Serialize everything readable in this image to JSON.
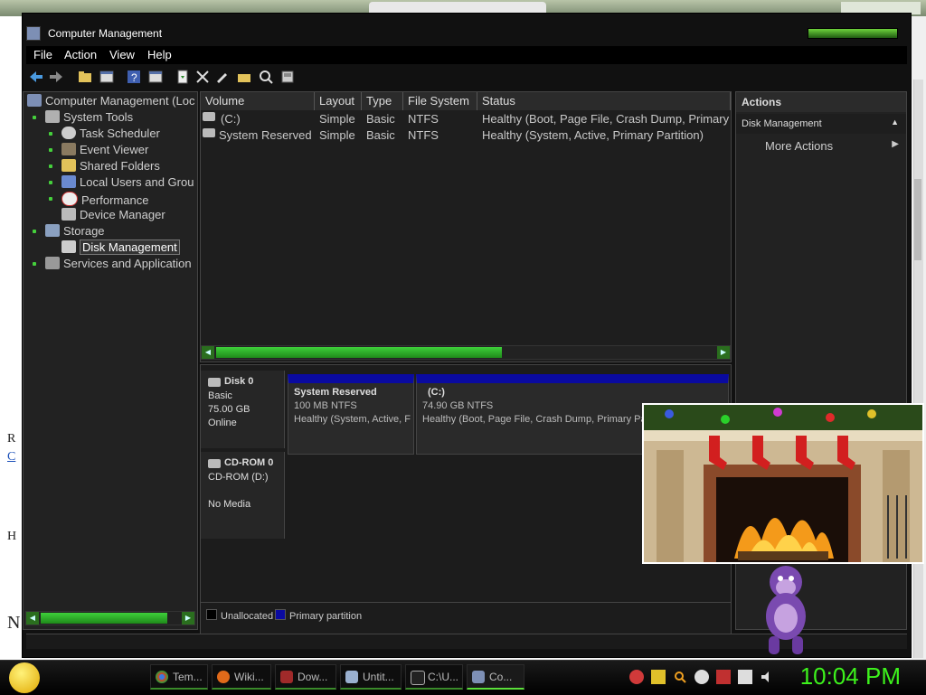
{
  "window": {
    "title": "Computer Management"
  },
  "menu": [
    "File",
    "Action",
    "View",
    "Help"
  ],
  "toolbar_icons": [
    "back-icon",
    "forward-icon",
    "up-folder-icon",
    "show-hide-tree-icon",
    "help-icon",
    "properties-icon",
    "refresh-icon",
    "delete-icon",
    "rename-icon",
    "open-folder-icon",
    "search-icon",
    "disk-icon"
  ],
  "tree": {
    "root": "Computer Management (Loc",
    "system_tools": "System Tools",
    "task_scheduler": "Task Scheduler",
    "event_viewer": "Event Viewer",
    "shared_folders": "Shared Folders",
    "local_users": "Local Users and Grou",
    "performance": "Performance",
    "device_manager": "Device Manager",
    "storage": "Storage",
    "disk_management": "Disk Management",
    "services": "Services and Application"
  },
  "volumes": {
    "columns": [
      "Volume",
      "Layout",
      "Type",
      "File System",
      "Status"
    ],
    "rows": [
      {
        "volume": "(C:)",
        "layout": "Simple",
        "type": "Basic",
        "fs": "NTFS",
        "status": "Healthy (Boot, Page File, Crash Dump, Primary"
      },
      {
        "volume": "System Reserved",
        "layout": "Simple",
        "type": "Basic",
        "fs": "NTFS",
        "status": "Healthy (System, Active, Primary Partition)"
      }
    ]
  },
  "disks": {
    "disk0": {
      "name": "Disk 0",
      "type": "Basic",
      "size": "75.00 GB",
      "state": "Online"
    },
    "cdrom0": {
      "name": "CD-ROM 0",
      "type": "CD-ROM (D:)",
      "state": "No Media"
    },
    "partitions": [
      {
        "name": "System Reserved",
        "size": "100 MB NTFS",
        "status": "Healthy (System, Active, F"
      },
      {
        "name": "(C:)",
        "size": "74.90 GB NTFS",
        "status": "Healthy (Boot, Page File, Crash Dump, Primary Partit"
      }
    ],
    "legend": {
      "unallocated": "Unallocated",
      "primary": "Primary partition"
    }
  },
  "actions": {
    "header": "Actions",
    "section": "Disk Management",
    "more": "More Actions"
  },
  "background_fragments": {
    "a": "R",
    "b": "C",
    "c": "H",
    "d": "N"
  },
  "taskbar": {
    "buttons": [
      {
        "label": "Tem...",
        "icon": "chrome-icon"
      },
      {
        "label": "Wiki...",
        "icon": "firefox-icon"
      },
      {
        "label": "Dow...",
        "icon": "download-icon"
      },
      {
        "label": "Untit...",
        "icon": "notepad-icon"
      },
      {
        "label": "C:\\U...",
        "icon": "cmd-icon"
      },
      {
        "label": "Co...",
        "icon": "computer-management-icon"
      }
    ],
    "clock": "10:04 PM"
  },
  "colors": {
    "accent": "#3df21c",
    "primary_partition": "#0a0aa0",
    "window_bg": "#111111"
  }
}
